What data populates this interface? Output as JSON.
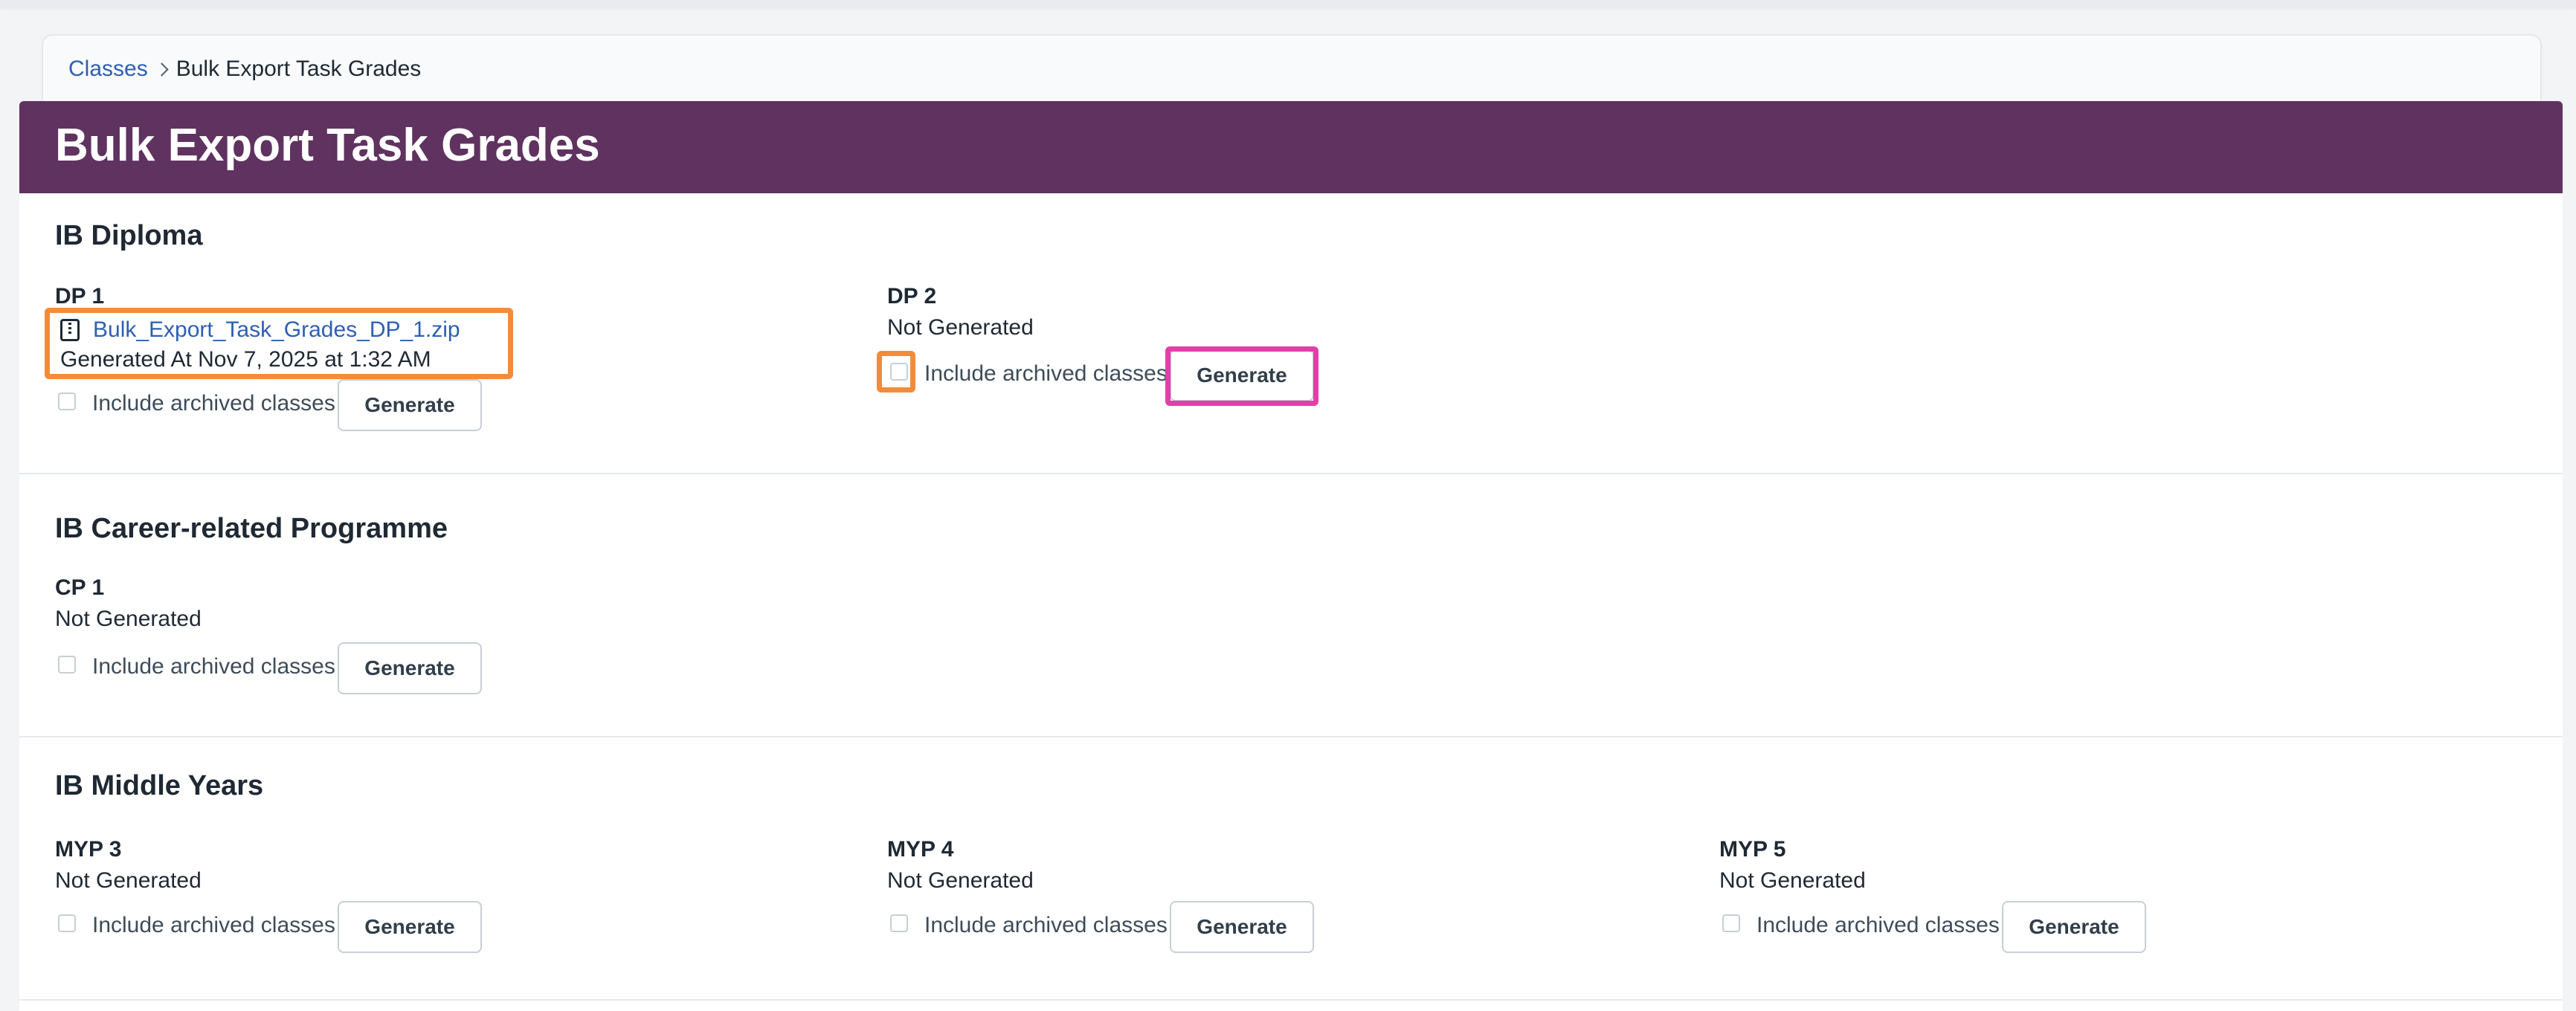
{
  "breadcrumb": {
    "link": "Classes",
    "current": "Bulk Export Task Grades"
  },
  "page": {
    "title": "Bulk Export Task Grades"
  },
  "common": {
    "include_archived_label": "Include archived classes",
    "generate_label": "Generate",
    "not_generated": "Not Generated"
  },
  "sections": [
    {
      "title": "IB Diploma",
      "grades": [
        {
          "name": "DP 1",
          "file_name": "Bulk_Export_Task_Grades_DP_1.zip",
          "generated_at": "Generated At Nov 7, 2025 at 1:32 AM"
        },
        {
          "name": "DP 2",
          "status": "Not Generated"
        }
      ]
    },
    {
      "title": "IB Career-related Programme",
      "grades": [
        {
          "name": "CP 1",
          "status": "Not Generated"
        }
      ]
    },
    {
      "title": "IB Middle Years",
      "grades": [
        {
          "name": "MYP 3",
          "status": "Not Generated"
        },
        {
          "name": "MYP 4",
          "status": "Not Generated"
        },
        {
          "name": "MYP 5",
          "status": "Not Generated"
        }
      ]
    }
  ],
  "colors": {
    "header_bg": "#5f3260",
    "link": "#2d5fb3",
    "highlight_orange": "#f28c3b",
    "highlight_pink": "#e23fa9"
  },
  "icons": {
    "file": "zip-file-icon",
    "breadcrumb_separator": "chevron-right-icon"
  }
}
